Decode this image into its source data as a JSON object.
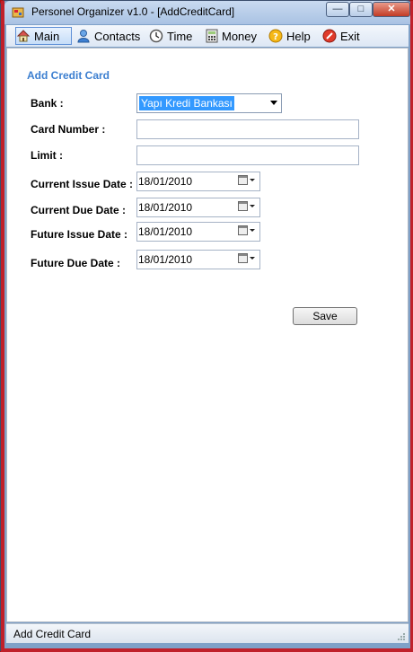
{
  "window": {
    "title": "Personel Organizer v1.0 - [AddCreditCard]",
    "minimize_label": "—",
    "maximize_label": "□",
    "close_label": "✕"
  },
  "menu": {
    "items": [
      {
        "label": "Main",
        "icon": "house-icon"
      },
      {
        "label": "Contacts",
        "icon": "contacts-icon"
      },
      {
        "label": "Time",
        "icon": "clock-icon"
      },
      {
        "label": "Money",
        "icon": "calculator-icon"
      },
      {
        "label": "Help",
        "icon": "help-icon"
      },
      {
        "label": "Exit",
        "icon": "exit-icon"
      }
    ]
  },
  "form": {
    "section_title": "Add Credit Card",
    "bank": {
      "label": "Bank :",
      "value": "Yapı Kredi Bankası"
    },
    "card_number": {
      "label": "Card Number :",
      "value": ""
    },
    "limit": {
      "label": "Limit :",
      "value": ""
    },
    "current_issue_date": {
      "label": "Current Issue Date :",
      "value": "18/01/2010"
    },
    "current_due_date": {
      "label": "Current Due Date :",
      "value": "18/01/2010"
    },
    "future_issue_date": {
      "label": "Future Issue  Date :",
      "value": "18/01/2010"
    },
    "future_due_date": {
      "label": "Future Due Date :",
      "value": "18/01/2010"
    },
    "save_label": "Save"
  },
  "status": {
    "text": "Add Credit Card"
  },
  "colors": {
    "accent": "#3c7fd0",
    "selection": "#3399ff",
    "frame": "#c0202a"
  }
}
